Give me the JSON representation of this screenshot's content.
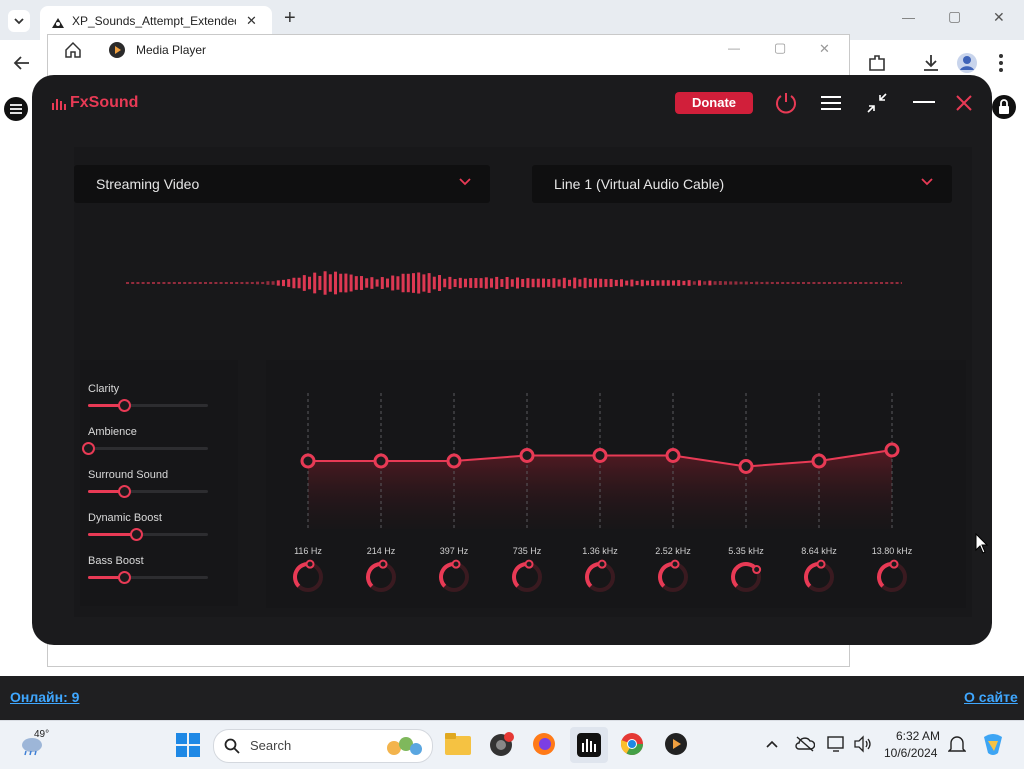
{
  "browser": {
    "tab_title": "XP_Sounds_Attempt_Extended_",
    "new_tab": "+",
    "win_min": "—",
    "win_max": "▢",
    "win_close": "✕"
  },
  "media_player": {
    "title": "Media Player"
  },
  "fxsound": {
    "brand": "FxSound",
    "donate_label": "Donate",
    "preset": "Streaming Video",
    "output_device": "Line 1 (Virtual Audio Cable)",
    "sliders": [
      {
        "label": "Clarity",
        "value": 0.3
      },
      {
        "label": "Ambience",
        "value": 0.0
      },
      {
        "label": "Surround Sound",
        "value": 0.3
      },
      {
        "label": "Dynamic Boost",
        "value": 0.4
      },
      {
        "label": "Bass Boost",
        "value": 0.3
      }
    ],
    "eq_bands": [
      {
        "freq": "116 Hz",
        "gain": 0.0
      },
      {
        "freq": "214 Hz",
        "gain": 0.0
      },
      {
        "freq": "397 Hz",
        "gain": 0.0
      },
      {
        "freq": "735 Hz",
        "gain": 0.1
      },
      {
        "freq": "1.36 kHz",
        "gain": 0.1
      },
      {
        "freq": "2.52 kHz",
        "gain": 0.1
      },
      {
        "freq": "5.35 kHz",
        "gain": -0.1
      },
      {
        "freq": "8.64 kHz",
        "gain": 0.0
      },
      {
        "freq": "13.80 kHz",
        "gain": 0.2
      }
    ],
    "accent": "#e83a55"
  },
  "status": {
    "online": "Онлайн: 9",
    "about": "О сайте"
  },
  "taskbar": {
    "weather_temp": "49°",
    "search_placeholder": "Search",
    "time": "6:32 AM",
    "date": "10/6/2024"
  }
}
